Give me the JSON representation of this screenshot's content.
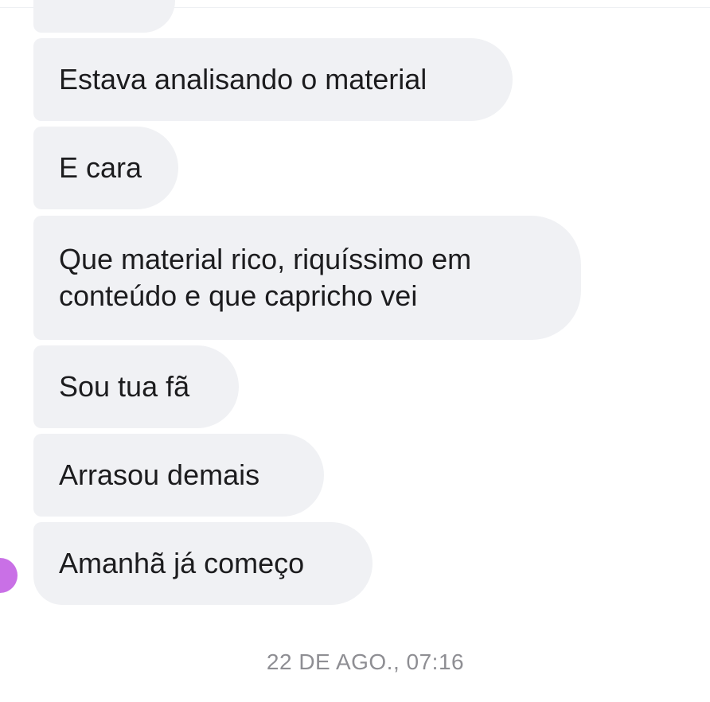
{
  "messages": [
    {
      "text": ""
    },
    {
      "text": "Estava analisando o material"
    },
    {
      "text": "E cara"
    },
    {
      "text": "Que material rico, riquíssimo em\nconteúdo e que capricho vei"
    },
    {
      "text": "Sou tua fã"
    },
    {
      "text": "Arrasou demais"
    },
    {
      "text": "Amanhã já começo"
    }
  ],
  "timestamp": "22 DE AGO., 07:16",
  "colors": {
    "bubble": "#f0f1f4",
    "avatar": "#c970e6",
    "timestamp": "#8e8e93"
  }
}
